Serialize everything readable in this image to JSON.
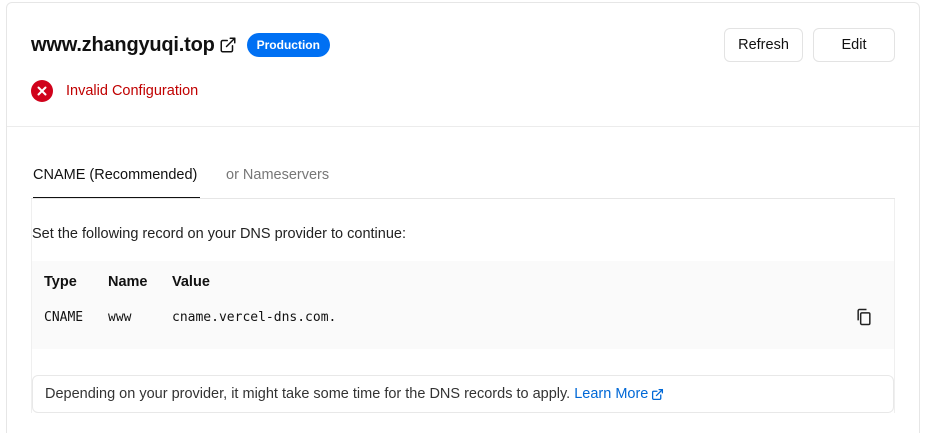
{
  "domain": {
    "name": "www.zhangyuqi.top",
    "environment_badge": "Production"
  },
  "actions": {
    "refresh_label": "Refresh",
    "edit_label": "Edit"
  },
  "status": {
    "text": "Invalid Configuration",
    "icon": "error-x-icon",
    "color": "#d0021b"
  },
  "tabs": [
    {
      "label": "CNAME (Recommended)",
      "active": true
    },
    {
      "label": "or Nameservers",
      "active": false
    }
  ],
  "instruction": "Set the following record on your DNS provider to continue:",
  "record": {
    "headers": [
      "Type",
      "Name",
      "Value"
    ],
    "row": [
      "CNAME",
      "www",
      "cname.vercel-dns.com."
    ]
  },
  "note": {
    "text": "Depending on your provider, it might take some time for the DNS records to apply.",
    "link_text": "Learn More"
  },
  "colors": {
    "accent": "#0070f3",
    "error": "#d0021b",
    "link": "#0068d6"
  }
}
